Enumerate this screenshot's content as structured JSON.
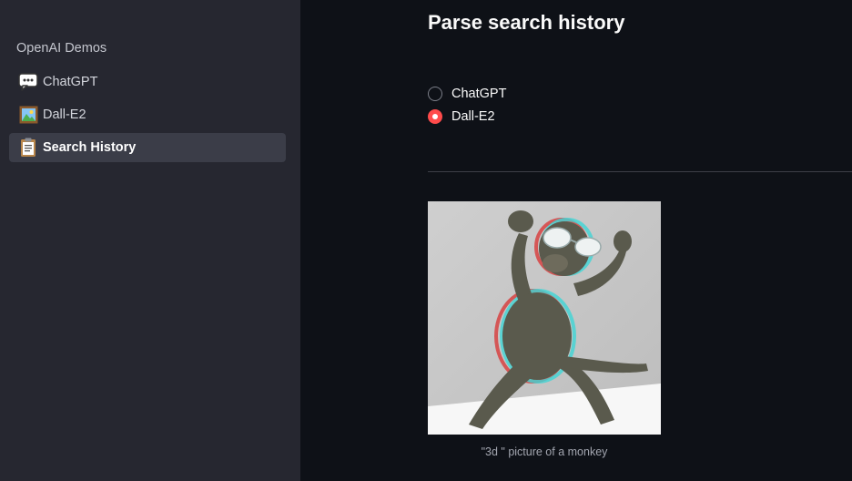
{
  "sidebar": {
    "heading": "OpenAI Demos",
    "items": [
      {
        "label": "ChatGPT",
        "icon": "speech-bubble-icon",
        "active": false
      },
      {
        "label": "Dall-E2",
        "icon": "framed-picture-icon",
        "active": false
      },
      {
        "label": "Search History",
        "icon": "clipboard-icon",
        "active": true
      }
    ]
  },
  "main": {
    "title": "Parse search history",
    "radio_options": [
      {
        "label": "ChatGPT",
        "checked": false
      },
      {
        "label": "Dall-E2",
        "checked": true
      }
    ],
    "image": {
      "caption": "\"3d \" picture of a monkey"
    }
  },
  "colors": {
    "background": "#0e1117",
    "sidebar": "#262730",
    "accent": "#ff4b4b"
  }
}
